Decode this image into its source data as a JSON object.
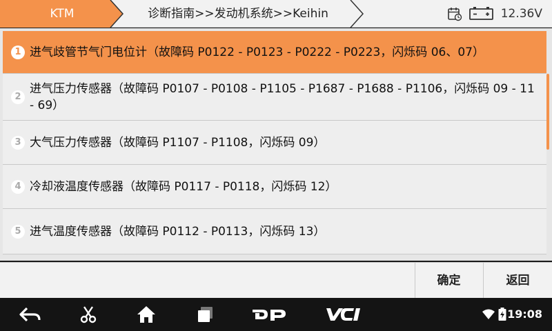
{
  "header": {
    "brand_tab": "KTM",
    "breadcrumb": "诊断指南>>发动机系统>>Keihin",
    "voltage": "12.36V"
  },
  "list": {
    "items": [
      {
        "number": "1",
        "text": "进气歧管节气门电位计（故障码 P0122 - P0123 - P0222 - P0223，闪烁码 06、07）",
        "selected": true
      },
      {
        "number": "2",
        "text": "进气压力传感器（故障码 P0107 - P0108 - P1105 - P1687 - P1688 - P1106，闪烁码 09 - 11 - 69）",
        "selected": false
      },
      {
        "number": "3",
        "text": "大气压力传感器（故障码 P1107 - P1108，闪烁码 09）",
        "selected": false
      },
      {
        "number": "4",
        "text": "冷却液温度传感器（故障码 P0117 - P0118，闪烁码 12）",
        "selected": false
      },
      {
        "number": "5",
        "text": "进气温度传感器（故障码 P0112 - P0113，闪烁码 13）",
        "selected": false
      }
    ]
  },
  "footer": {
    "confirm_label": "确定",
    "back_label": "返回"
  },
  "navbar": {
    "clock": "19:08"
  },
  "colors": {
    "accent": "#f4924b",
    "navbar": "#141414"
  }
}
